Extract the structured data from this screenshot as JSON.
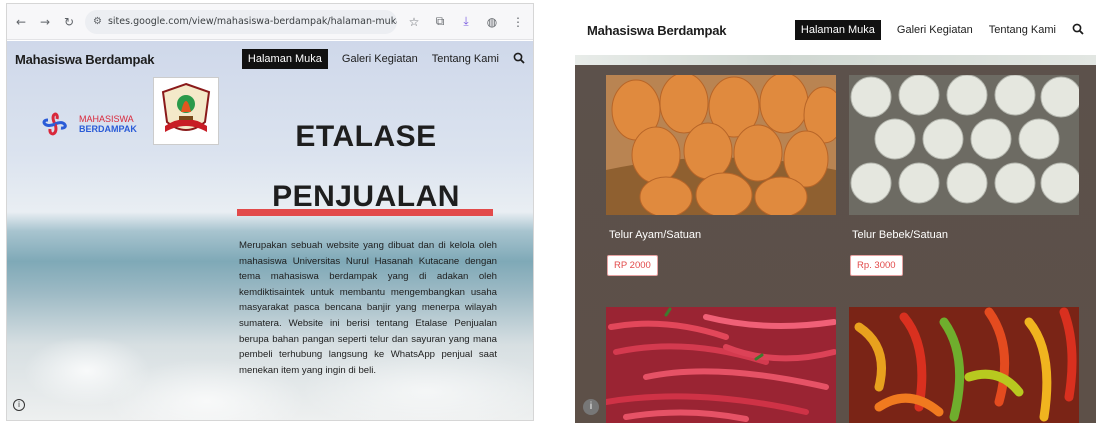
{
  "browser": {
    "url": "sites.google.com/view/mahasiswa-berdampak/halaman-muka",
    "icons": [
      "back-icon",
      "forward-icon",
      "reload-icon",
      "tune-icon",
      "star-icon",
      "extensions-icon",
      "download-icon",
      "profile-icon",
      "kebab-menu-icon"
    ]
  },
  "site": {
    "brand": "Mahasiswa Berdampak",
    "nav": {
      "home": "Halaman Muka",
      "gallery": "Galeri Kegiatan",
      "about": "Tentang Kami"
    }
  },
  "hero": {
    "logo_word1": "MAHA",
    "logo_word1b": "SISWA",
    "logo_word2": "BERDAMPAK",
    "title_line1": "ETALASE",
    "title_line2": "PENJUALAN",
    "description": "Merupakan sebuah website yang dibuat dan di kelola oleh mahasiswa Universitas Nurul Hasanah Kutacane dengan tema mahasiswa berdampak yang di adakan oleh kemdiktisaintek untuk membantu mengembangkan usaha masyarakat pasca bencana banjir yang menerpa wilayah sumatera. Website ini berisi tentang Etalase Penjualan berupa bahan pangan seperti telur dan sayuran yang mana pembeli terhubung langsung ke WhatsApp penjual saat menekan item yang ingin di beli."
  },
  "products": [
    {
      "name": "Telur Ayam/Satuan",
      "price": "RP 2000"
    },
    {
      "name": "Telur Bebek/Satuan",
      "price": "Rp. 3000"
    }
  ],
  "colors": {
    "accent_red": "#e24a4a",
    "nav_active_bg": "#111111",
    "product_bg": "#5b504a"
  }
}
